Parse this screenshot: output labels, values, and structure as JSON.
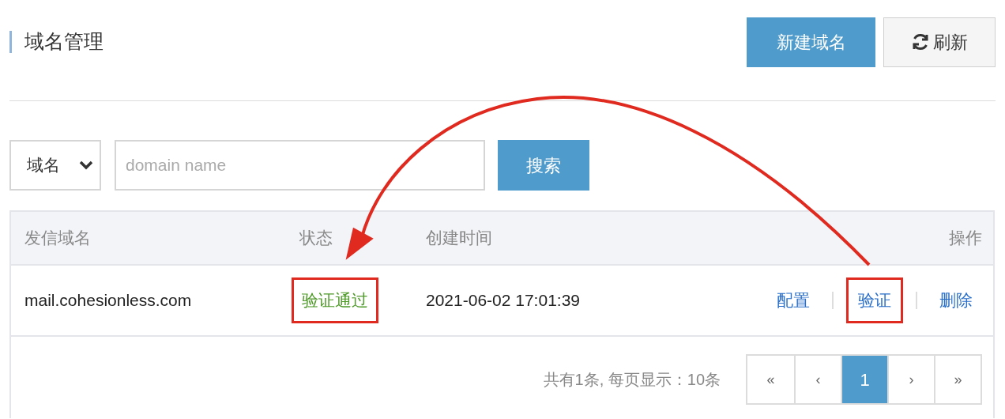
{
  "page_title": "域名管理",
  "header_buttons": [
    {
      "label": "新建域名",
      "kind": "primary"
    },
    {
      "label": "刷新",
      "kind": "refresh"
    }
  ],
  "search": {
    "field_select": "域名",
    "placeholder": "domain name",
    "button": "搜索"
  },
  "table": {
    "columns": [
      "发信域名",
      "状态",
      "创建时间",
      "操作"
    ],
    "rows": [
      {
        "domain": "mail.cohesionless.com",
        "status": "验证通过",
        "status_highlighted": true,
        "created": "2021-06-02 17:01:39",
        "actions": [
          {
            "label": "配置",
            "highlighted": false
          },
          {
            "label": "验证",
            "highlighted": true
          },
          {
            "label": "删除",
            "highlighted": false
          }
        ]
      }
    ]
  },
  "footer": {
    "summary": "共有1条, 每页显示：10条",
    "pages": [
      {
        "label": "«",
        "selected": false
      },
      {
        "label": "‹",
        "selected": false
      },
      {
        "label": "1",
        "selected": true
      },
      {
        "label": "›",
        "selected": false
      },
      {
        "label": "»",
        "selected": false
      }
    ]
  },
  "annotation_arrow": true
}
